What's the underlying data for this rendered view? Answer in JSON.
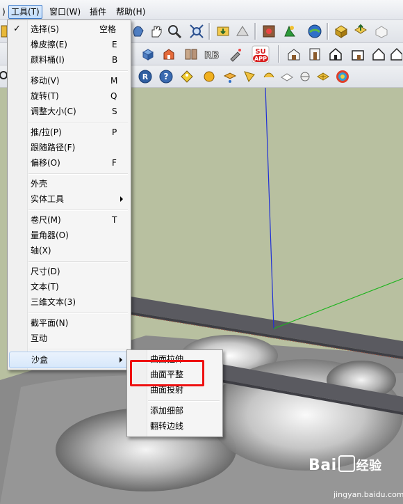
{
  "menubar": {
    "items": [
      {
        "label": ")"
      },
      {
        "label": "工具(T)"
      },
      {
        "label": "窗口(W)"
      },
      {
        "label": "插件"
      },
      {
        "label": "帮助(H)"
      }
    ]
  },
  "tools_menu": {
    "items": [
      {
        "label": "选择(S)",
        "shortcut": "空格",
        "checked": true
      },
      {
        "label": "橡皮擦(E)",
        "shortcut": "E"
      },
      {
        "label": "颜料桶(I)",
        "shortcut": "B"
      },
      {
        "label": "移动(V)",
        "shortcut": "M"
      },
      {
        "label": "旋转(T)",
        "shortcut": "Q"
      },
      {
        "label": "调整大小(C)",
        "shortcut": "S"
      },
      {
        "label": "推/拉(P)",
        "shortcut": "P"
      },
      {
        "label": "跟随路径(F)",
        "shortcut": ""
      },
      {
        "label": "偏移(O)",
        "shortcut": "F"
      },
      {
        "label": "外壳",
        "shortcut": ""
      },
      {
        "label": "实体工具",
        "shortcut": ""
      },
      {
        "label": "卷尺(M)",
        "shortcut": "T"
      },
      {
        "label": "量角器(O)",
        "shortcut": ""
      },
      {
        "label": "轴(X)",
        "shortcut": ""
      },
      {
        "label": "尺寸(D)",
        "shortcut": ""
      },
      {
        "label": "文本(T)",
        "shortcut": ""
      },
      {
        "label": "三维文本(3)",
        "shortcut": ""
      },
      {
        "label": "截平面(N)",
        "shortcut": ""
      },
      {
        "label": "互动",
        "shortcut": ""
      },
      {
        "label": "沙盒",
        "shortcut": ""
      }
    ]
  },
  "sandbox_submenu": {
    "items": [
      {
        "label": "曲面拉伸"
      },
      {
        "label": "曲面平整"
      },
      {
        "label": "曲面投射"
      },
      {
        "label": "添加细部"
      },
      {
        "label": "翻转边线"
      }
    ]
  },
  "toolbar": {
    "su_app_line1": "SU",
    "su_app_line2": "APP"
  },
  "watermark": {
    "brand_a": "Bai",
    "brand_b": "经验",
    "url": "jingyan.baidu.com"
  },
  "colors": {
    "highlight_box": "#e11111",
    "blue_axis": "#1f2fd6",
    "green_axis": "#1db31d",
    "viewport_bg": "#b8c0a0"
  }
}
